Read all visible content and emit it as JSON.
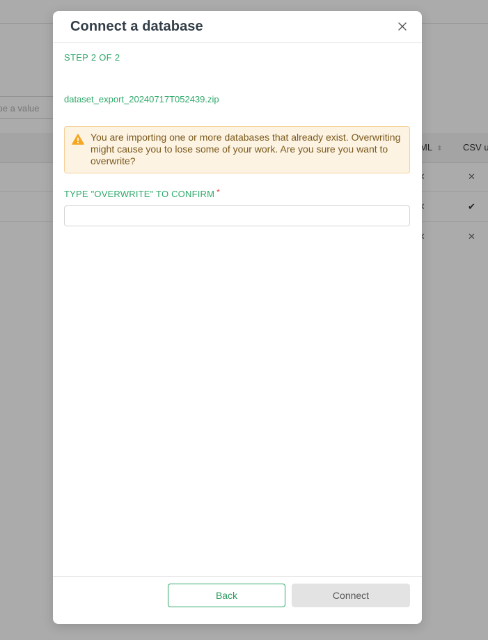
{
  "background": {
    "search_placeholder": "ype a value",
    "table_headers": [
      "ML",
      "CSV u"
    ],
    "rows": [
      {
        "xml": "✕",
        "csv": "✕"
      },
      {
        "xml": "✕",
        "csv": "✔"
      },
      {
        "xml": "✕",
        "csv": "✕"
      }
    ]
  },
  "modal": {
    "title": "Connect a database",
    "step": "STEP 2 OF 2",
    "file_name": "dataset_export_20240717T052439.zip",
    "warning": "You are importing one or more databases that already exist. Overwriting might cause you to lose some of your work. Are you sure you want to overwrite?",
    "confirm_label": "TYPE \"OVERWRITE\" TO CONFIRM",
    "required_mark": "*",
    "confirm_value": "",
    "buttons": {
      "back": "Back",
      "connect": "Connect"
    }
  },
  "colors": {
    "accent_green": "#2fa86a",
    "warning_bg": "#fdf3e3",
    "warning_border": "#f4cf95",
    "warning_icon": "#f5a623",
    "required": "#e04545"
  },
  "icons": {
    "close": "close-icon",
    "warning": "warning-icon",
    "sort": "sort-icon"
  }
}
